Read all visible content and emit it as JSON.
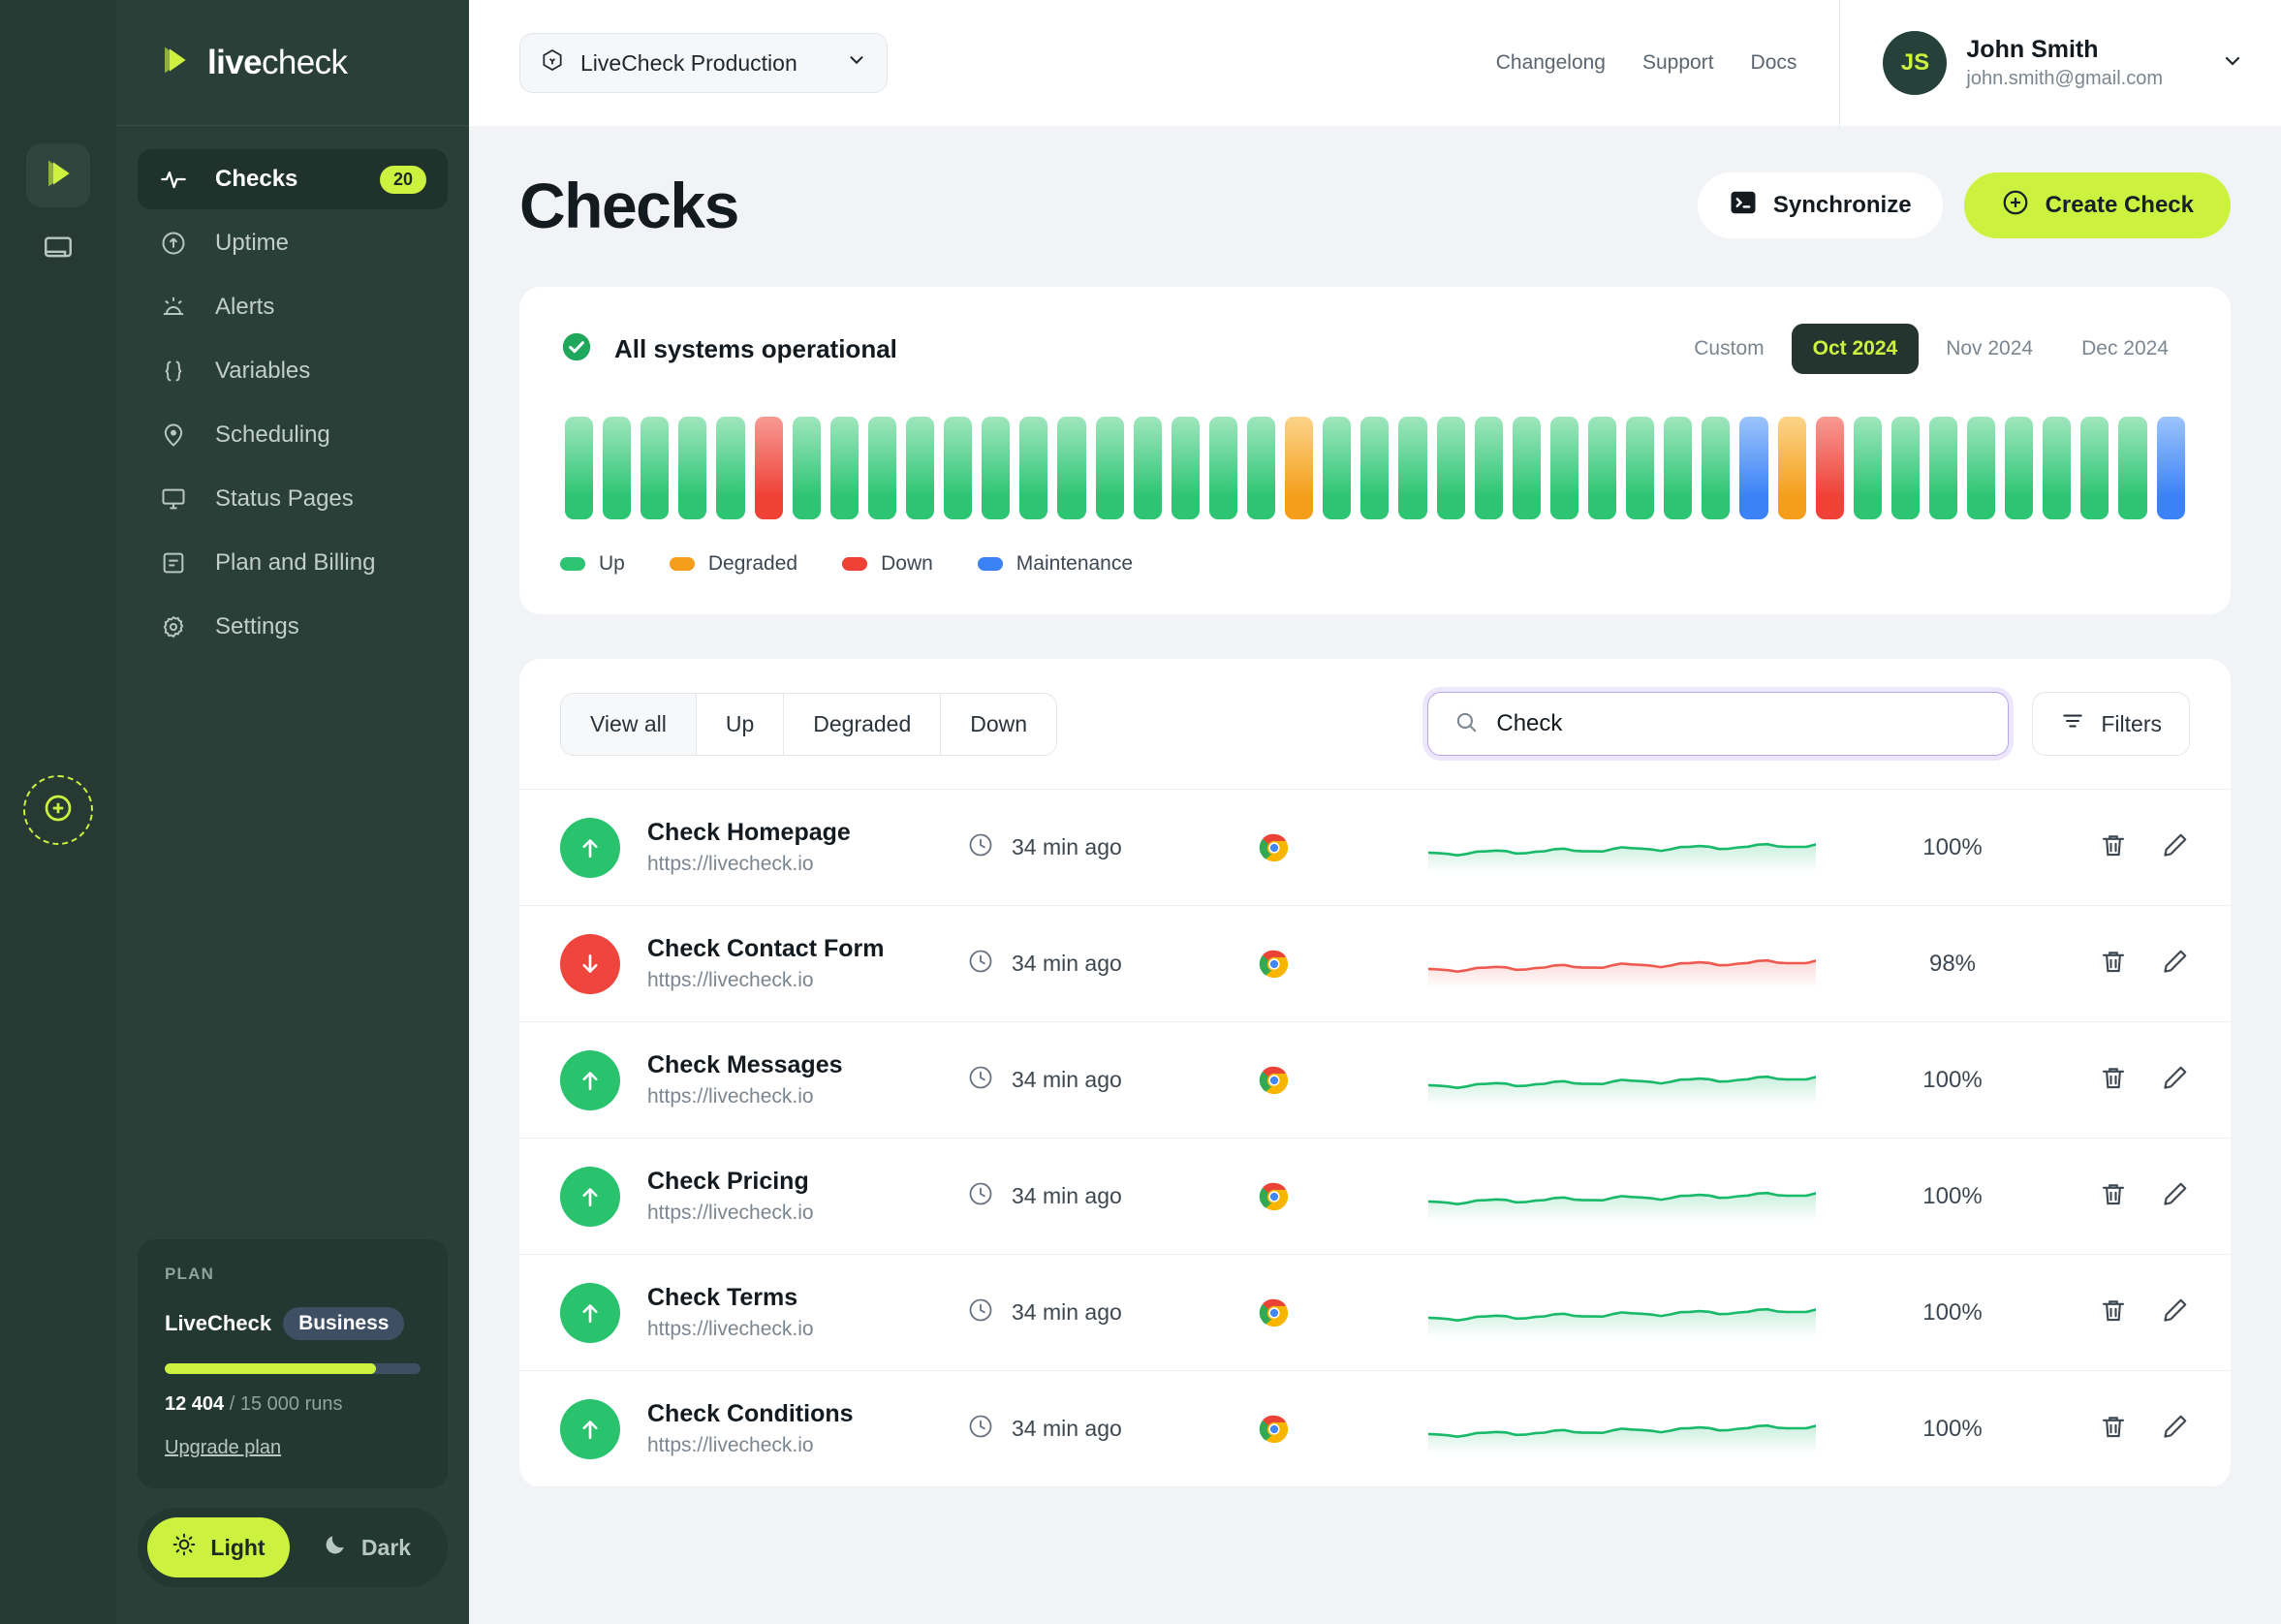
{
  "brand": {
    "bold": "live",
    "light": "check"
  },
  "rail": {
    "logo_icon": "livecheck-logo-mark",
    "docs_icon": "book-icon",
    "add_icon": "plus-circle-icon"
  },
  "sidebar": {
    "items": [
      {
        "label": "Checks",
        "icon": "activity-pulse-icon",
        "badge": "20",
        "active": true
      },
      {
        "label": "Uptime",
        "icon": "arrow-up-circle-icon",
        "badge": "",
        "active": false
      },
      {
        "label": "Alerts",
        "icon": "alarm-light-icon",
        "badge": "",
        "active": false
      },
      {
        "label": "Variables",
        "icon": "curly-braces-icon",
        "badge": "",
        "active": false
      },
      {
        "label": "Scheduling",
        "icon": "map-pin-icon",
        "badge": "",
        "active": false
      },
      {
        "label": "Status Pages",
        "icon": "monitor-icon",
        "badge": "",
        "active": false
      },
      {
        "label": "Plan and Billing",
        "icon": "document-lines-icon",
        "badge": "",
        "active": false
      },
      {
        "label": "Settings",
        "icon": "gear-icon",
        "badge": "",
        "active": false
      }
    ],
    "plan": {
      "label": "PLAN",
      "product": "LiveCheck",
      "tier": "Business",
      "used": "12 404",
      "total": "/ 15 000 runs",
      "progress_pct": 82.7,
      "upgrade_link": "Upgrade plan"
    },
    "theme": {
      "light_label": "Light",
      "dark_label": "Dark",
      "light_icon": "sun-icon",
      "dark_icon": "moon-icon",
      "active": "Light"
    }
  },
  "topbar": {
    "project": "LiveCheck Production",
    "project_icon": "hexagon-icon",
    "chevron_icon": "chevron-down-icon",
    "links": [
      "Changelong",
      "Support",
      "Docs"
    ],
    "user": {
      "initials": "JS",
      "name": "John Smith",
      "email": "john.smith@gmail.com"
    }
  },
  "page": {
    "title": "Checks",
    "sync_label": "Synchronize",
    "sync_icon": "terminal-icon",
    "create_label": "Create Check",
    "create_icon": "plus-circle-icon"
  },
  "status": {
    "headline": "All systems operational",
    "check_icon": "check-circle-icon",
    "periods": [
      {
        "label": "Custom",
        "active": false
      },
      {
        "label": "Oct 2024",
        "active": true
      },
      {
        "label": "Nov 2024",
        "active": false
      },
      {
        "label": "Dec 2024",
        "active": false
      }
    ],
    "legend": [
      {
        "label": "Up",
        "color": "#2dc574"
      },
      {
        "label": "Degraded",
        "color": "#f59e1b"
      },
      {
        "label": "Down",
        "color": "#ef4136"
      },
      {
        "label": "Maintenance",
        "color": "#3b82f6"
      }
    ],
    "bar_colors": {
      "up": "#2dc574",
      "degraded": "#f59e1b",
      "down": "#ef4136",
      "maintenance": "#3b82f6"
    },
    "bars": [
      "up",
      "up",
      "up",
      "up",
      "up",
      "down",
      "up",
      "up",
      "up",
      "up",
      "up",
      "up",
      "up",
      "up",
      "up",
      "up",
      "up",
      "up",
      "up",
      "degraded",
      "up",
      "up",
      "up",
      "up",
      "up",
      "up",
      "up",
      "up",
      "up",
      "up",
      "up",
      "maintenance",
      "degraded",
      "down",
      "up",
      "up",
      "up",
      "up",
      "up",
      "up",
      "up",
      "up",
      "maintenance"
    ]
  },
  "list": {
    "tabs": [
      {
        "label": "View all",
        "active": true
      },
      {
        "label": "Up",
        "active": false
      },
      {
        "label": "Degraded",
        "active": false
      },
      {
        "label": "Down",
        "active": false
      }
    ],
    "search": {
      "value": "Check",
      "placeholder": "Search",
      "icon": "search-icon"
    },
    "filters_label": "Filters",
    "filters_icon": "filter-lines-icon",
    "delete_icon": "trash-icon",
    "edit_icon": "pencil-icon",
    "clock_icon": "clock-icon",
    "browser_icon": "chrome-icon",
    "rows": [
      {
        "name": "Check Homepage",
        "url": "https://livecheck.io",
        "time": "34 min ago",
        "status": "up",
        "pct": "100%"
      },
      {
        "name": "Check Contact Form",
        "url": "https://livecheck.io",
        "time": "34 min ago",
        "status": "down",
        "pct": "98%"
      },
      {
        "name": "Check Messages",
        "url": "https://livecheck.io",
        "time": "34 min ago",
        "status": "up",
        "pct": "100%"
      },
      {
        "name": "Check Pricing",
        "url": "https://livecheck.io",
        "time": "34 min ago",
        "status": "up",
        "pct": "100%"
      },
      {
        "name": "Check Terms",
        "url": "https://livecheck.io",
        "time": "34 min ago",
        "status": "up",
        "pct": "100%"
      },
      {
        "name": "Check Conditions",
        "url": "https://livecheck.io",
        "time": "34 min ago",
        "status": "up",
        "pct": "100%"
      }
    ]
  }
}
